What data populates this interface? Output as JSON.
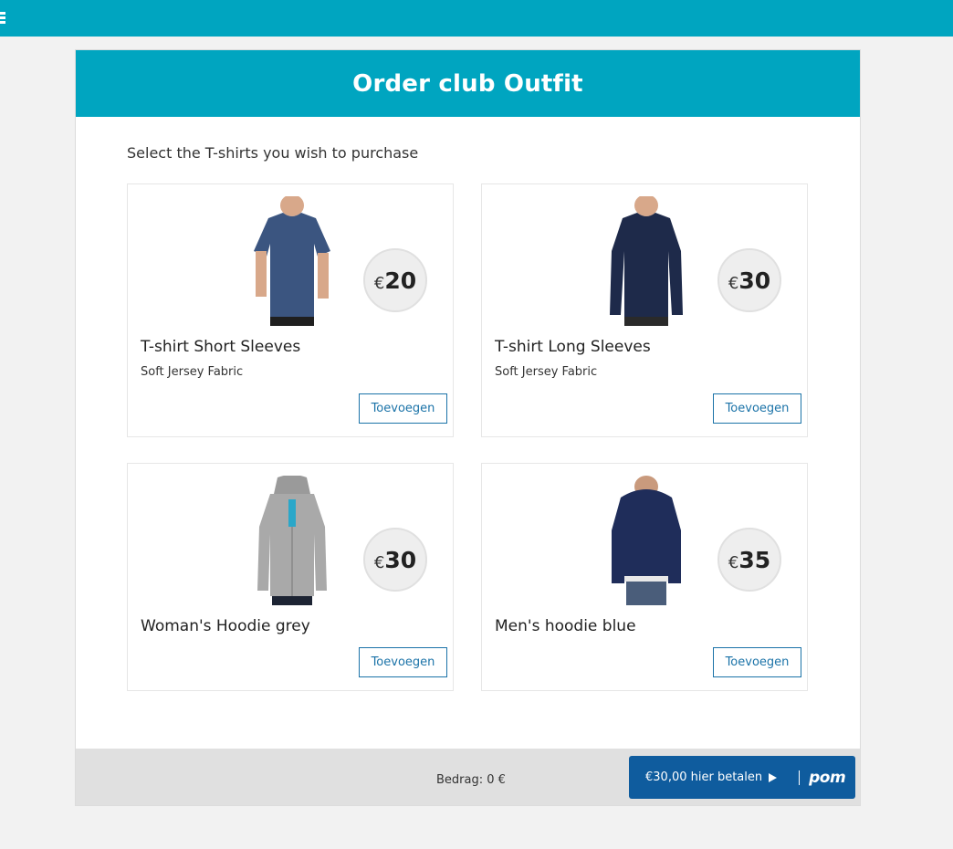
{
  "topbar": {
    "menu_icon": "hamburger-icon"
  },
  "page": {
    "title": "Order club Outfit",
    "intro": "Select the T-shirts you wish to purchase"
  },
  "products": [
    {
      "name": "T-shirt Short Sleeves",
      "description": "Soft Jersey Fabric",
      "currency": "€",
      "price": "20",
      "add_label": "Toevoegen",
      "image": "short-sleeve-tshirt-image",
      "color": "#3b5580"
    },
    {
      "name": "T-shirt Long Sleeves",
      "description": "Soft Jersey Fabric",
      "currency": "€",
      "price": "30",
      "add_label": "Toevoegen",
      "image": "long-sleeve-tshirt-image",
      "color": "#1e2a4a"
    },
    {
      "name": "Woman's Hoodie grey",
      "currency": "€",
      "price": "30",
      "add_label": "Toevoegen",
      "image": "grey-hoodie-image",
      "color": "#a9a9a9"
    },
    {
      "name": "Men's hoodie blue",
      "currency": "€",
      "price": "35",
      "add_label": "Toevoegen",
      "image": "blue-hoodie-image",
      "color": "#1f2d5a"
    }
  ],
  "footer": {
    "amount": "Bedrag: 0 €",
    "pay_label": "€30,00 hier betalen",
    "pay_logo": "pom"
  },
  "colors": {
    "brand": "#00a5c0",
    "pay_button": "#0f5c9e",
    "link": "#1b73a8"
  }
}
